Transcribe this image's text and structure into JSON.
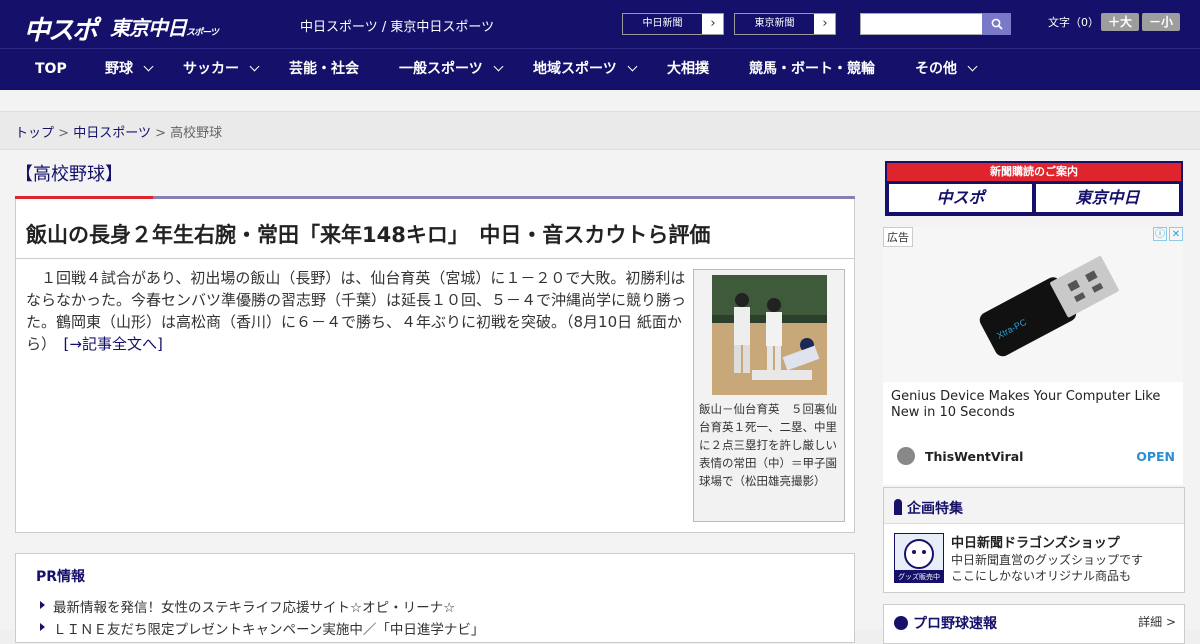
{
  "header": {
    "logo_main": "中スポ",
    "logo_sub": "東京中日",
    "logo_sub_small": "スポーツ",
    "site_name": "中日スポーツ / 東京中日スポーツ",
    "paper_buttons": [
      "中日新聞",
      "東京新聞"
    ],
    "font_label": "文字（0）",
    "font_bigger": "＋大",
    "font_smaller": "－小"
  },
  "nav": {
    "items": [
      {
        "label": "TOP",
        "dropdown": false
      },
      {
        "label": "野球",
        "dropdown": true
      },
      {
        "label": "サッカー",
        "dropdown": true
      },
      {
        "label": "芸能・社会",
        "dropdown": false
      },
      {
        "label": "一般スポーツ",
        "dropdown": true
      },
      {
        "label": "地域スポーツ",
        "dropdown": true
      },
      {
        "label": "大相撲",
        "dropdown": false
      },
      {
        "label": "競馬・ボート・競輪",
        "dropdown": false
      },
      {
        "label": "その他",
        "dropdown": true
      }
    ]
  },
  "breadcrumb": {
    "home": "トップ",
    "section": "中日スポーツ",
    "current": "高校野球",
    "sep": ">"
  },
  "article": {
    "section_title": "【高校野球】",
    "headline": "飯山の長身２年生右腕・常田「来年148キロ」　中日・音スカウトら評価",
    "body": "　１回戦４試合があり、初出場の飯山（長野）は、仙台育英（宮城）に１－２０で大敗。初勝利はならなかった。今春センバツ準優勝の習志野（千葉）は延長１０回、５－４で沖縄尚学に競り勝った。鶴岡東（山形）は高松商（香川）に６－４で勝ち、４年ぶりに初戦を突破。（8月10日 紙面から）",
    "read_more": "[→記事全文へ]",
    "photo_caption": "飯山－仙台育英　５回裏仙台育英１死一、二塁、中里に２点三塁打を許し厳しい表情の常田（中）＝甲子園球場で（松田雄亮撮影）"
  },
  "pr": {
    "title": "PR情報",
    "items": [
      "最新情報を発信！女性のステキライフ応援サイト☆オピ・リーナ☆",
      "ＬＩＮＥ友だち限定プレゼントキャンペーン実施中／「中日進学ナビ」"
    ]
  },
  "sidebar": {
    "subscribe_title": "新聞購読のご案内",
    "subscribe_logos": [
      "中スポ",
      "東京中日"
    ],
    "ad": {
      "label": "広告",
      "text": "Genius Device Makes Your Computer Like New in 10 Seconds",
      "source": "ThisWentViral",
      "open": "OPEN",
      "usb_brand": "Xtra-PC"
    },
    "feature": {
      "title": "企画特集",
      "item_name": "中日新聞ドラゴンズショップ",
      "item_desc_1": "中日新聞直営のグッズショップです",
      "item_desc_2": "ここにしかないオリジナル商品も",
      "thumb_label": "グッズ販売中"
    },
    "score": {
      "title": "プロ野球速報",
      "more": "詳細 >"
    }
  },
  "colors": {
    "brand_navy": "#15116b",
    "accent_red": "#e0242e"
  }
}
